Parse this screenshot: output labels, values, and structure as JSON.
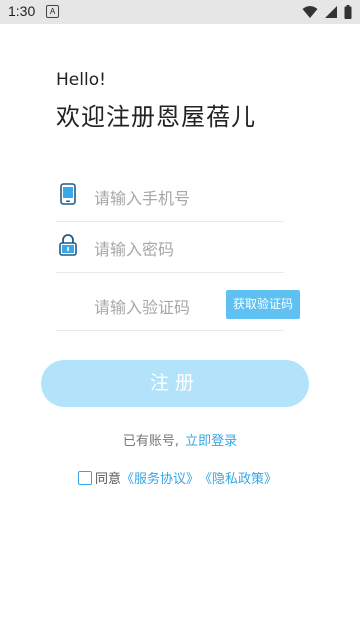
{
  "status": {
    "time": "1:30",
    "a_label": "A"
  },
  "greeting": "Hello!",
  "welcome": "欢迎注册恩屋蓓儿",
  "phone": {
    "placeholder": "请输入手机号",
    "icon": "phone-icon"
  },
  "password": {
    "placeholder": "请输入密码",
    "icon": "lock-icon"
  },
  "code": {
    "placeholder": "请输入验证码",
    "button": "获取验证码"
  },
  "register_button": "注册",
  "login": {
    "prefix": "已有账号,",
    "link": "立即登录"
  },
  "agreement": {
    "prefix": "同意",
    "service": "《服务协议》",
    "privacy": "《隐私政策》"
  },
  "colors": {
    "accent": "#5ec1f2",
    "button": "#b3e3fb",
    "link": "#37a6e6"
  }
}
